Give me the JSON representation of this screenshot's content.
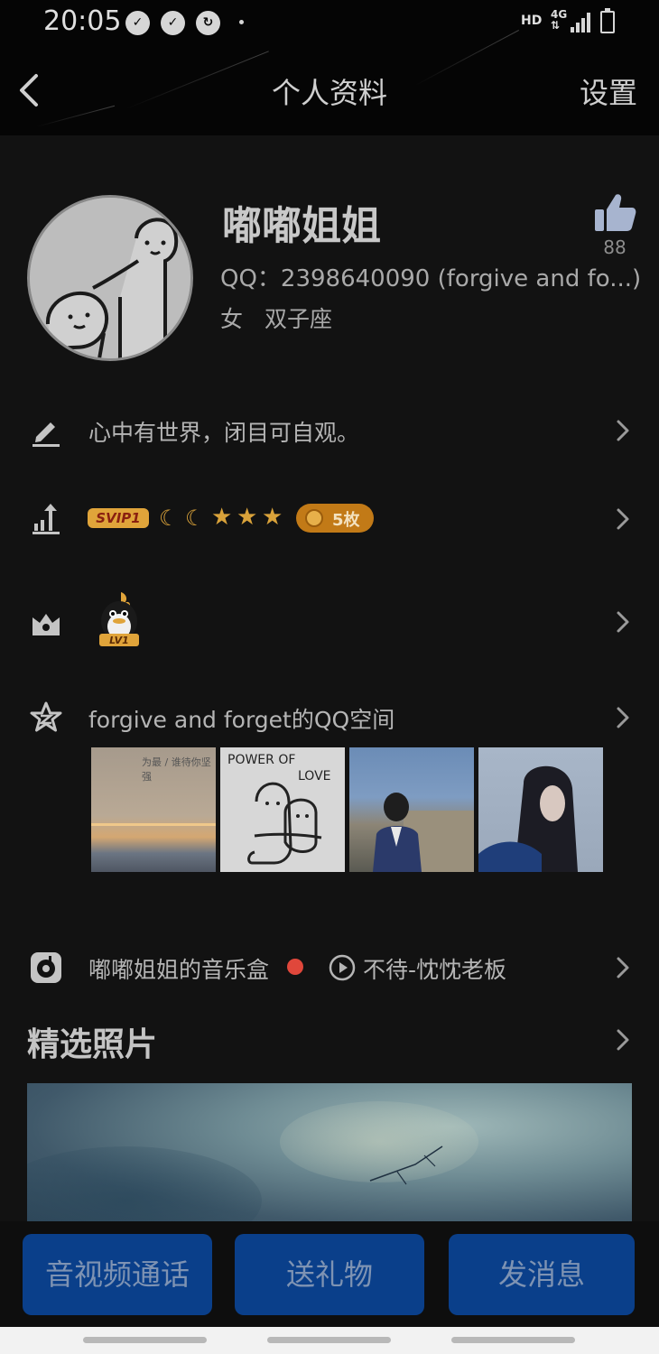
{
  "status_bar": {
    "time": "20:05",
    "network": "HD",
    "network_type": "4G"
  },
  "header": {
    "title": "个人资料",
    "settings_label": "设置"
  },
  "profile": {
    "nickname": "嘟嘟姐姐",
    "like_count": "88",
    "qq_line": "QQ：2398640090 (forgive and fo...)",
    "gender": "女",
    "zodiac": "双子座"
  },
  "signature": {
    "text": "心中有世界，闭目可自观。"
  },
  "level": {
    "vip_badge": "SVIP1",
    "medal_count": "5枚",
    "moons": 2,
    "stars": 3
  },
  "qzone": {
    "title": "forgive and forget的QQ空间",
    "thumb1_text": "为最 / 谁待你坚强",
    "thumb2_text_1": "POWER OF",
    "thumb2_text_2": "LOVE"
  },
  "music": {
    "title": "嘟嘟姐姐的音乐盒",
    "song": "不待-忱忱老板"
  },
  "photos": {
    "title": "精选照片"
  },
  "bottom_bar": {
    "call_label": "音视频通话",
    "gift_label": "送礼物",
    "message_label": "发消息"
  },
  "colors": {
    "background": "#121212",
    "button_blue": "#0a3f8a",
    "gold": "#d9a23a",
    "red_dot": "#e0473b"
  }
}
